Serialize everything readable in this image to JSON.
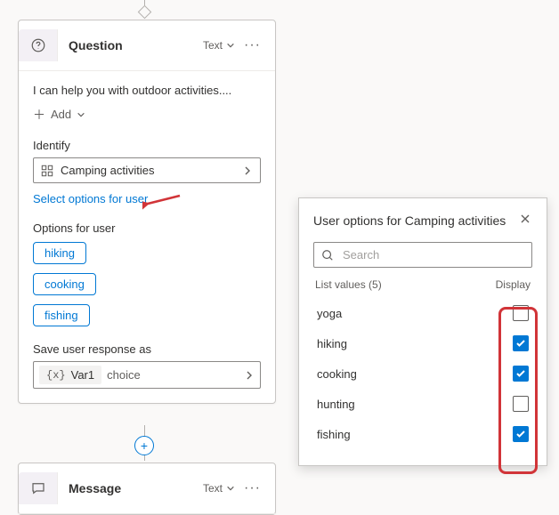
{
  "question_card": {
    "title": "Question",
    "type_label": "Text",
    "prompt": "I can help you with outdoor activities....",
    "add_label": "Add",
    "identify_label": "Identify",
    "entity_value": "Camping activities",
    "select_options_link": "Select options for user",
    "options_label": "Options for user",
    "chips": [
      "hiking",
      "cooking",
      "fishing"
    ],
    "save_as_label": "Save user response as",
    "var_name": "Var1",
    "var_type": "choice"
  },
  "message_card": {
    "title": "Message",
    "type_label": "Text"
  },
  "popup": {
    "title": "User options for Camping activities",
    "search_placeholder": "Search",
    "list_values_label": "List values (5)",
    "display_label": "Display",
    "items": [
      {
        "label": "yoga",
        "checked": false
      },
      {
        "label": "hiking",
        "checked": true
      },
      {
        "label": "cooking",
        "checked": true
      },
      {
        "label": "hunting",
        "checked": false
      },
      {
        "label": "fishing",
        "checked": true
      }
    ]
  }
}
